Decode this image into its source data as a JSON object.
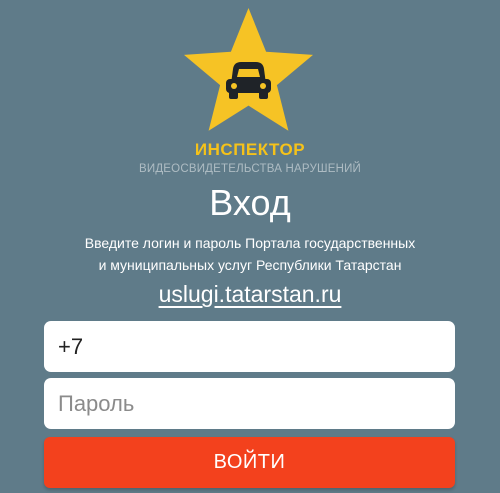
{
  "brand": {
    "logo_icon": "star-car-icon",
    "title": "ИНСПЕКТОР",
    "subtitle": "ВИДЕОСВИДЕТЕЛЬСТВА НАРУШЕНИЙ"
  },
  "login": {
    "heading": "Вход",
    "description_line1": "Введите логин и пароль Портала государственных",
    "description_line2": "и муниципальных услуг Республики Татарстан",
    "portal_link": "uslugi.tatarstan.ru",
    "phone_value": "+7",
    "password_placeholder": "Пароль",
    "submit_label": "ВОЙТИ"
  },
  "colors": {
    "background": "#5f7b89",
    "star": "#f6c325",
    "brand_title": "#f5c21a",
    "button": "#f3411d"
  }
}
